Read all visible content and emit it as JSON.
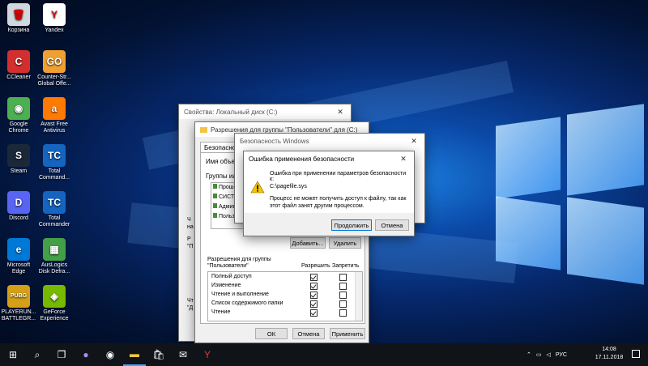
{
  "desktop_icons": [
    {
      "label": "Корзина",
      "icon": "recycle-bin-icon",
      "color": "#cfd8dc",
      "glyph": "🗑"
    },
    {
      "label": "Yandex",
      "icon": "yandex-icon",
      "color": "#ffffff",
      "glyph": "Y"
    },
    {
      "label": "CCleaner",
      "icon": "ccleaner-icon",
      "color": "#d32f2f",
      "glyph": "C"
    },
    {
      "label": "Counter-Str... Global Offe...",
      "icon": "csgo-icon",
      "color": "#f0a030",
      "glyph": "GO"
    },
    {
      "label": "Google Chrome",
      "icon": "chrome-icon",
      "color": "#4caf50",
      "glyph": "◉"
    },
    {
      "label": "Avast Free Antivirus",
      "icon": "avast-icon",
      "color": "#ff7a00",
      "glyph": "a"
    },
    {
      "label": "Steam",
      "icon": "steam-icon",
      "color": "#1b2838",
      "glyph": "S"
    },
    {
      "label": "Total Command...",
      "icon": "total-commander-icon",
      "color": "#1565c0",
      "glyph": "TC"
    },
    {
      "label": "Discord",
      "icon": "discord-icon",
      "color": "#5865f2",
      "glyph": "D"
    },
    {
      "label": "Total Commander",
      "icon": "total-commander-icon",
      "color": "#1565c0",
      "glyph": "TC"
    },
    {
      "label": "Microsoft Edge",
      "icon": "edge-icon",
      "color": "#0078d7",
      "glyph": "e"
    },
    {
      "label": "AusLogics Disk Defra...",
      "icon": "auslogics-icon",
      "color": "#43a047",
      "glyph": "▦"
    },
    {
      "label": "PLAYERUN... BATTLEGR...",
      "icon": "pubg-icon",
      "color": "#d4a017",
      "glyph": "PUBG"
    },
    {
      "label": "GeForce Experience",
      "icon": "geforce-icon",
      "color": "#76b900",
      "glyph": "◈"
    }
  ],
  "props_window": {
    "title": "Свойства: Локальный диск (C:)",
    "truncated_labels": [
      "Ч",
      "на",
      "Р",
      "\"П",
      "Чт",
      "\"Д"
    ]
  },
  "perm_window": {
    "title": "Разрешения для группы \"Пользователи\" для (C:)",
    "tab": "Безопасность",
    "object_label": "Имя объект",
    "groups_label": "Группы или",
    "group_prefix": "Гр",
    "groups": [
      "Прошед",
      "СИСТЕ",
      "Админ",
      "Польз"
    ],
    "add_button": "Добавить...",
    "remove_button": "Удалить",
    "perm_header": "Разрешения для группы \"Пользователи\"",
    "col_allow": "Разрешить",
    "col_deny": "Запретить",
    "permissions": [
      {
        "name": "Полный доступ",
        "allow": true,
        "deny": false
      },
      {
        "name": "Изменение",
        "allow": true,
        "deny": false
      },
      {
        "name": "Чтение и выполнение",
        "allow": true,
        "deny": false
      },
      {
        "name": "Список содержимого папки",
        "allow": true,
        "deny": false
      },
      {
        "name": "Чтение",
        "allow": true,
        "deny": false
      }
    ],
    "ok": "ОК",
    "cancel": "Отмена",
    "apply": "Применить"
  },
  "security_window": {
    "title": "Безопасность Windows"
  },
  "error_dialog": {
    "title": "Ошибка применения безопасности",
    "line1": "Ошибка при применении параметров безопасности к:",
    "path": "C:\\pagefile.sys",
    "message": "Процесс не может получить доступ к файлу, так как этот файл занят другим процессом.",
    "continue": "Продолжить",
    "cancel": "Отмена"
  },
  "taskbar": {
    "apps": [
      "start-icon",
      "search-icon",
      "task-view-icon",
      "cortana-icon",
      "chrome-icon",
      "file-explorer-icon",
      "store-icon",
      "mail-icon",
      "yandex-icon"
    ],
    "lang": "РУС",
    "time": "14:08",
    "date": "17.11.2018"
  }
}
